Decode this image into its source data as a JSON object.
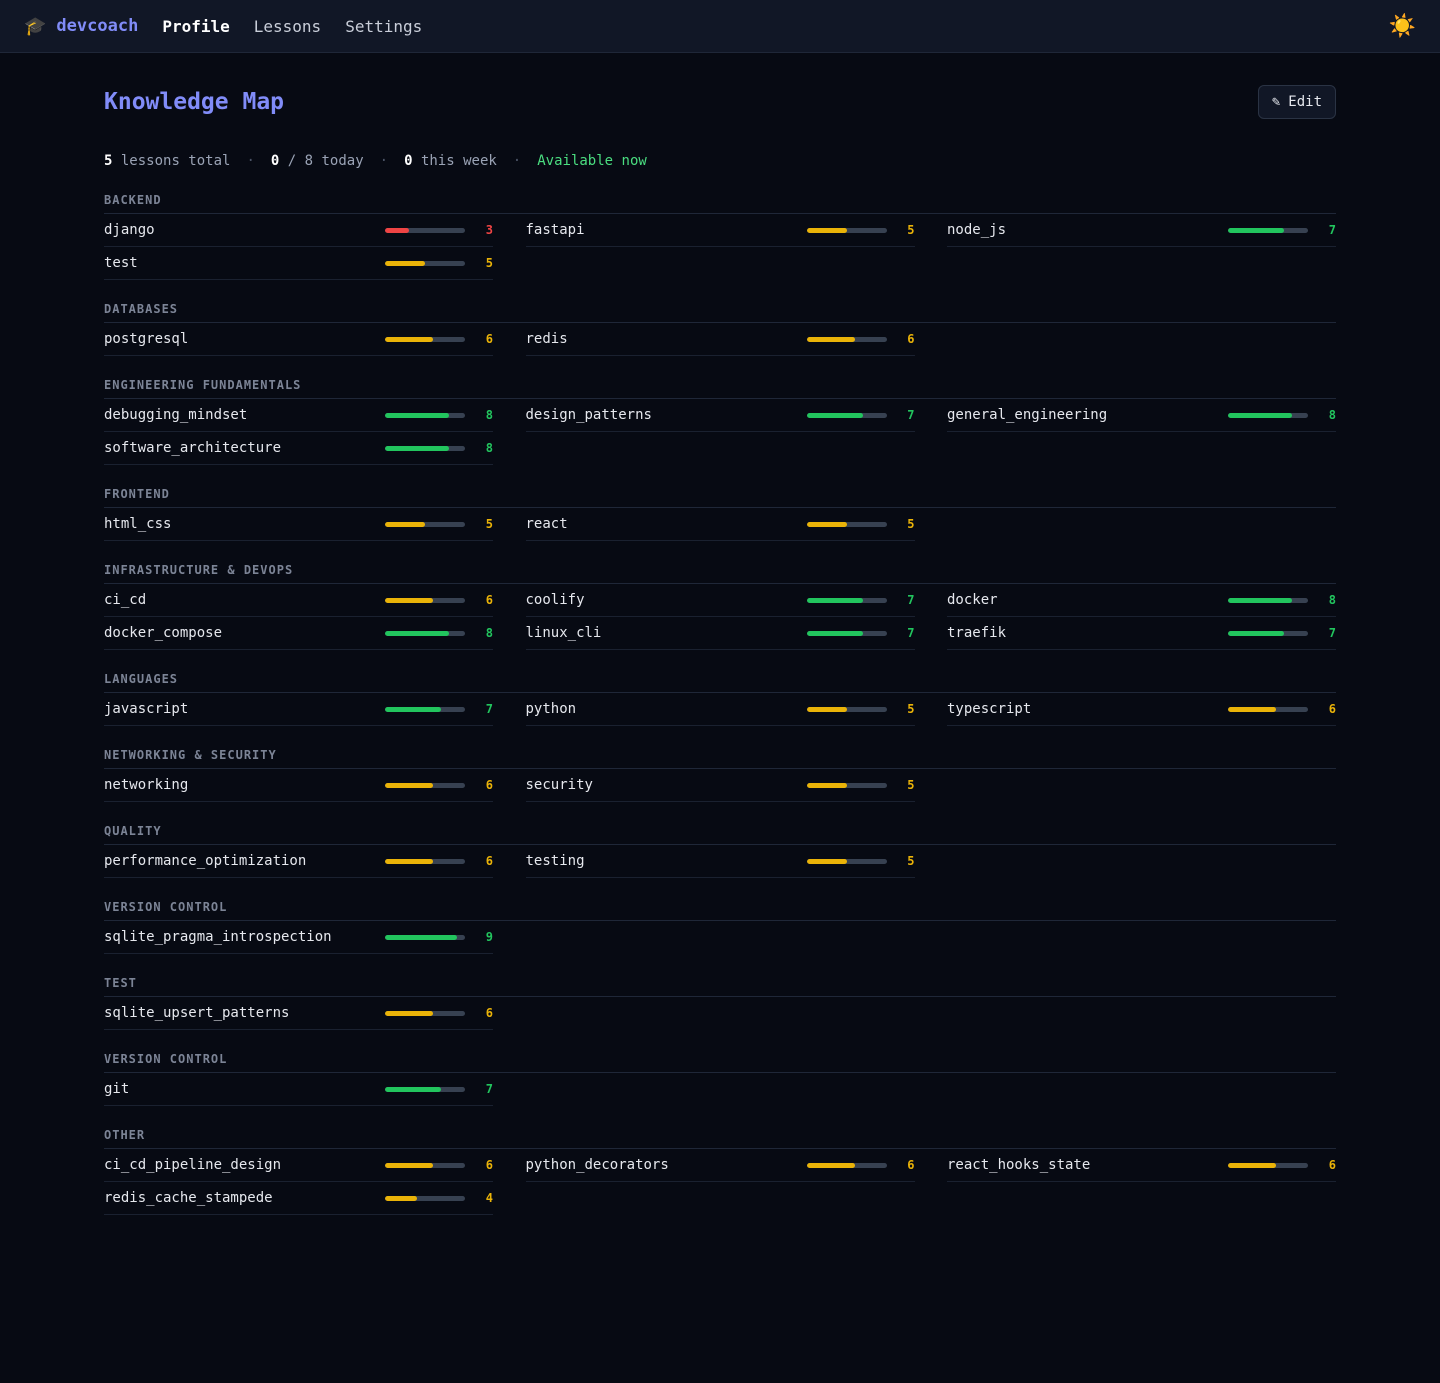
{
  "app": {
    "name": "devcoach",
    "nav": [
      {
        "label": "Profile",
        "active": true
      },
      {
        "label": "Lessons",
        "active": false
      },
      {
        "label": "Settings",
        "active": false
      }
    ]
  },
  "page": {
    "title": "Knowledge Map",
    "edit_label": "Edit"
  },
  "stats": {
    "lessons_total": "5",
    "lessons_total_label": "lessons total",
    "today_count": "0",
    "today_label": "/ 8 today",
    "week_count": "0",
    "week_label": "this week",
    "availability": "Available now"
  },
  "colors": {
    "low": "#ef4444",
    "mid": "#eab308",
    "high": "#22c55e",
    "accent": "#818cf8"
  },
  "scale_max": 10,
  "categories": [
    {
      "title": "BACKEND",
      "skills": [
        {
          "name": "django",
          "score": 3
        },
        {
          "name": "fastapi",
          "score": 5
        },
        {
          "name": "node_js",
          "score": 7
        },
        {
          "name": "test",
          "score": 5
        }
      ]
    },
    {
      "title": "DATABASES",
      "skills": [
        {
          "name": "postgresql",
          "score": 6
        },
        {
          "name": "redis",
          "score": 6
        }
      ]
    },
    {
      "title": "ENGINEERING FUNDAMENTALS",
      "skills": [
        {
          "name": "debugging_mindset",
          "score": 8
        },
        {
          "name": "design_patterns",
          "score": 7
        },
        {
          "name": "general_engineering",
          "score": 8
        },
        {
          "name": "software_architecture",
          "score": 8
        }
      ]
    },
    {
      "title": "FRONTEND",
      "skills": [
        {
          "name": "html_css",
          "score": 5
        },
        {
          "name": "react",
          "score": 5
        }
      ]
    },
    {
      "title": "INFRASTRUCTURE & DEVOPS",
      "skills": [
        {
          "name": "ci_cd",
          "score": 6
        },
        {
          "name": "coolify",
          "score": 7
        },
        {
          "name": "docker",
          "score": 8
        },
        {
          "name": "docker_compose",
          "score": 8
        },
        {
          "name": "linux_cli",
          "score": 7
        },
        {
          "name": "traefik",
          "score": 7
        }
      ]
    },
    {
      "title": "LANGUAGES",
      "skills": [
        {
          "name": "javascript",
          "score": 7
        },
        {
          "name": "python",
          "score": 5
        },
        {
          "name": "typescript",
          "score": 6
        }
      ]
    },
    {
      "title": "NETWORKING & SECURITY",
      "skills": [
        {
          "name": "networking",
          "score": 6
        },
        {
          "name": "security",
          "score": 5
        }
      ]
    },
    {
      "title": "QUALITY",
      "skills": [
        {
          "name": "performance_optimization",
          "score": 6
        },
        {
          "name": "testing",
          "score": 5
        }
      ]
    },
    {
      "title": "VERSION CONTROL",
      "skills": [
        {
          "name": "sqlite_pragma_introspection",
          "score": 9
        }
      ]
    },
    {
      "title": "TEST",
      "skills": [
        {
          "name": "sqlite_upsert_patterns",
          "score": 6
        }
      ]
    },
    {
      "title": "VERSION CONTROL",
      "skills": [
        {
          "name": "git",
          "score": 7
        }
      ]
    },
    {
      "title": "OTHER",
      "skills": [
        {
          "name": "ci_cd_pipeline_design",
          "score": 6
        },
        {
          "name": "python_decorators",
          "score": 6
        },
        {
          "name": "react_hooks_state",
          "score": 6
        },
        {
          "name": "redis_cache_stampede",
          "score": 4
        }
      ]
    }
  ]
}
